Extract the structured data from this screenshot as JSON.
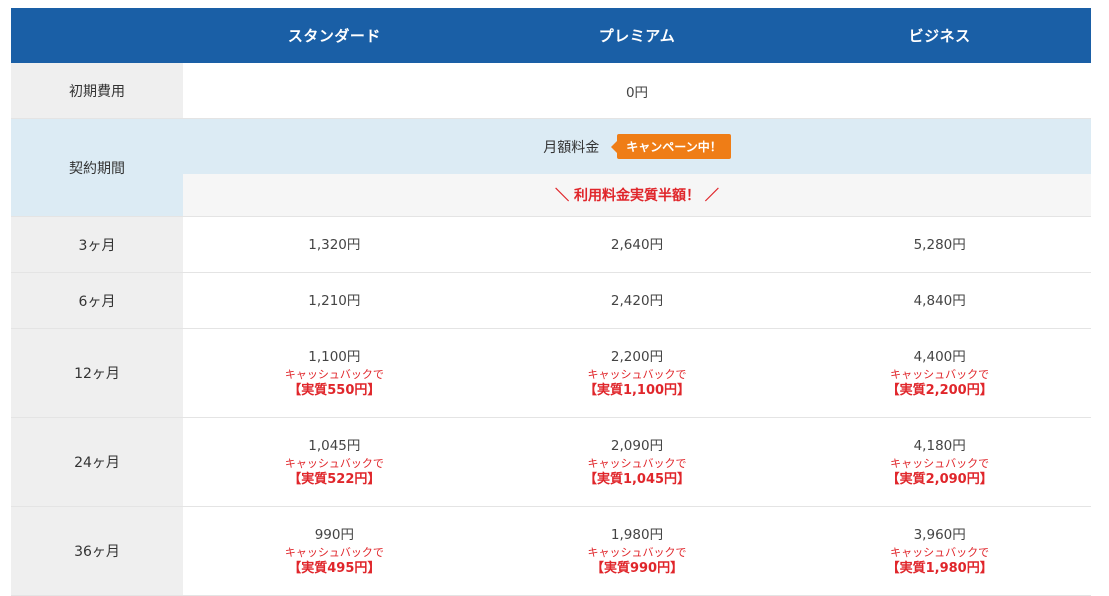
{
  "header": {
    "plans": [
      "スタンダード",
      "プレミアム",
      "ビジネス"
    ]
  },
  "initial_fee": {
    "label": "初期費用",
    "value": "0円"
  },
  "contract": {
    "label": "契約期間",
    "monthly_label": "月額料金",
    "campaign_badge": "キャンペーン中！",
    "half_off": "＼ 利用料金実質半額！ ／"
  },
  "rows": [
    {
      "term": "3ヶ月",
      "prices": [
        {
          "price": "1,320円"
        },
        {
          "price": "2,640円"
        },
        {
          "price": "5,280円"
        }
      ]
    },
    {
      "term": "6ヶ月",
      "prices": [
        {
          "price": "1,210円"
        },
        {
          "price": "2,420円"
        },
        {
          "price": "4,840円"
        }
      ]
    },
    {
      "term": "12ヶ月",
      "prices": [
        {
          "price": "1,100円",
          "cashback": "キャッシュバックで",
          "effective": "【実質550円】"
        },
        {
          "price": "2,200円",
          "cashback": "キャッシュバックで",
          "effective": "【実質1,100円】"
        },
        {
          "price": "4,400円",
          "cashback": "キャッシュバックで",
          "effective": "【実質2,200円】"
        }
      ]
    },
    {
      "term": "24ヶ月",
      "prices": [
        {
          "price": "1,045円",
          "cashback": "キャッシュバックで",
          "effective": "【実質522円】"
        },
        {
          "price": "2,090円",
          "cashback": "キャッシュバックで",
          "effective": "【実質1,045円】"
        },
        {
          "price": "4,180円",
          "cashback": "キャッシュバックで",
          "effective": "【実質2,090円】"
        }
      ]
    },
    {
      "term": "36ヶ月",
      "prices": [
        {
          "price": "990円",
          "cashback": "キャッシュバックで",
          "effective": "【実質495円】"
        },
        {
          "price": "1,980円",
          "cashback": "キャッシュバックで",
          "effective": "【実質990円】"
        },
        {
          "price": "3,960円",
          "cashback": "キャッシュバックで",
          "effective": "【実質1,980円】"
        }
      ]
    }
  ],
  "colors": {
    "header_bg": "#1a5fa6",
    "accent_red": "#e0262b",
    "badge_orange": "#ef7d16",
    "light_blue": "#dcebf4"
  }
}
